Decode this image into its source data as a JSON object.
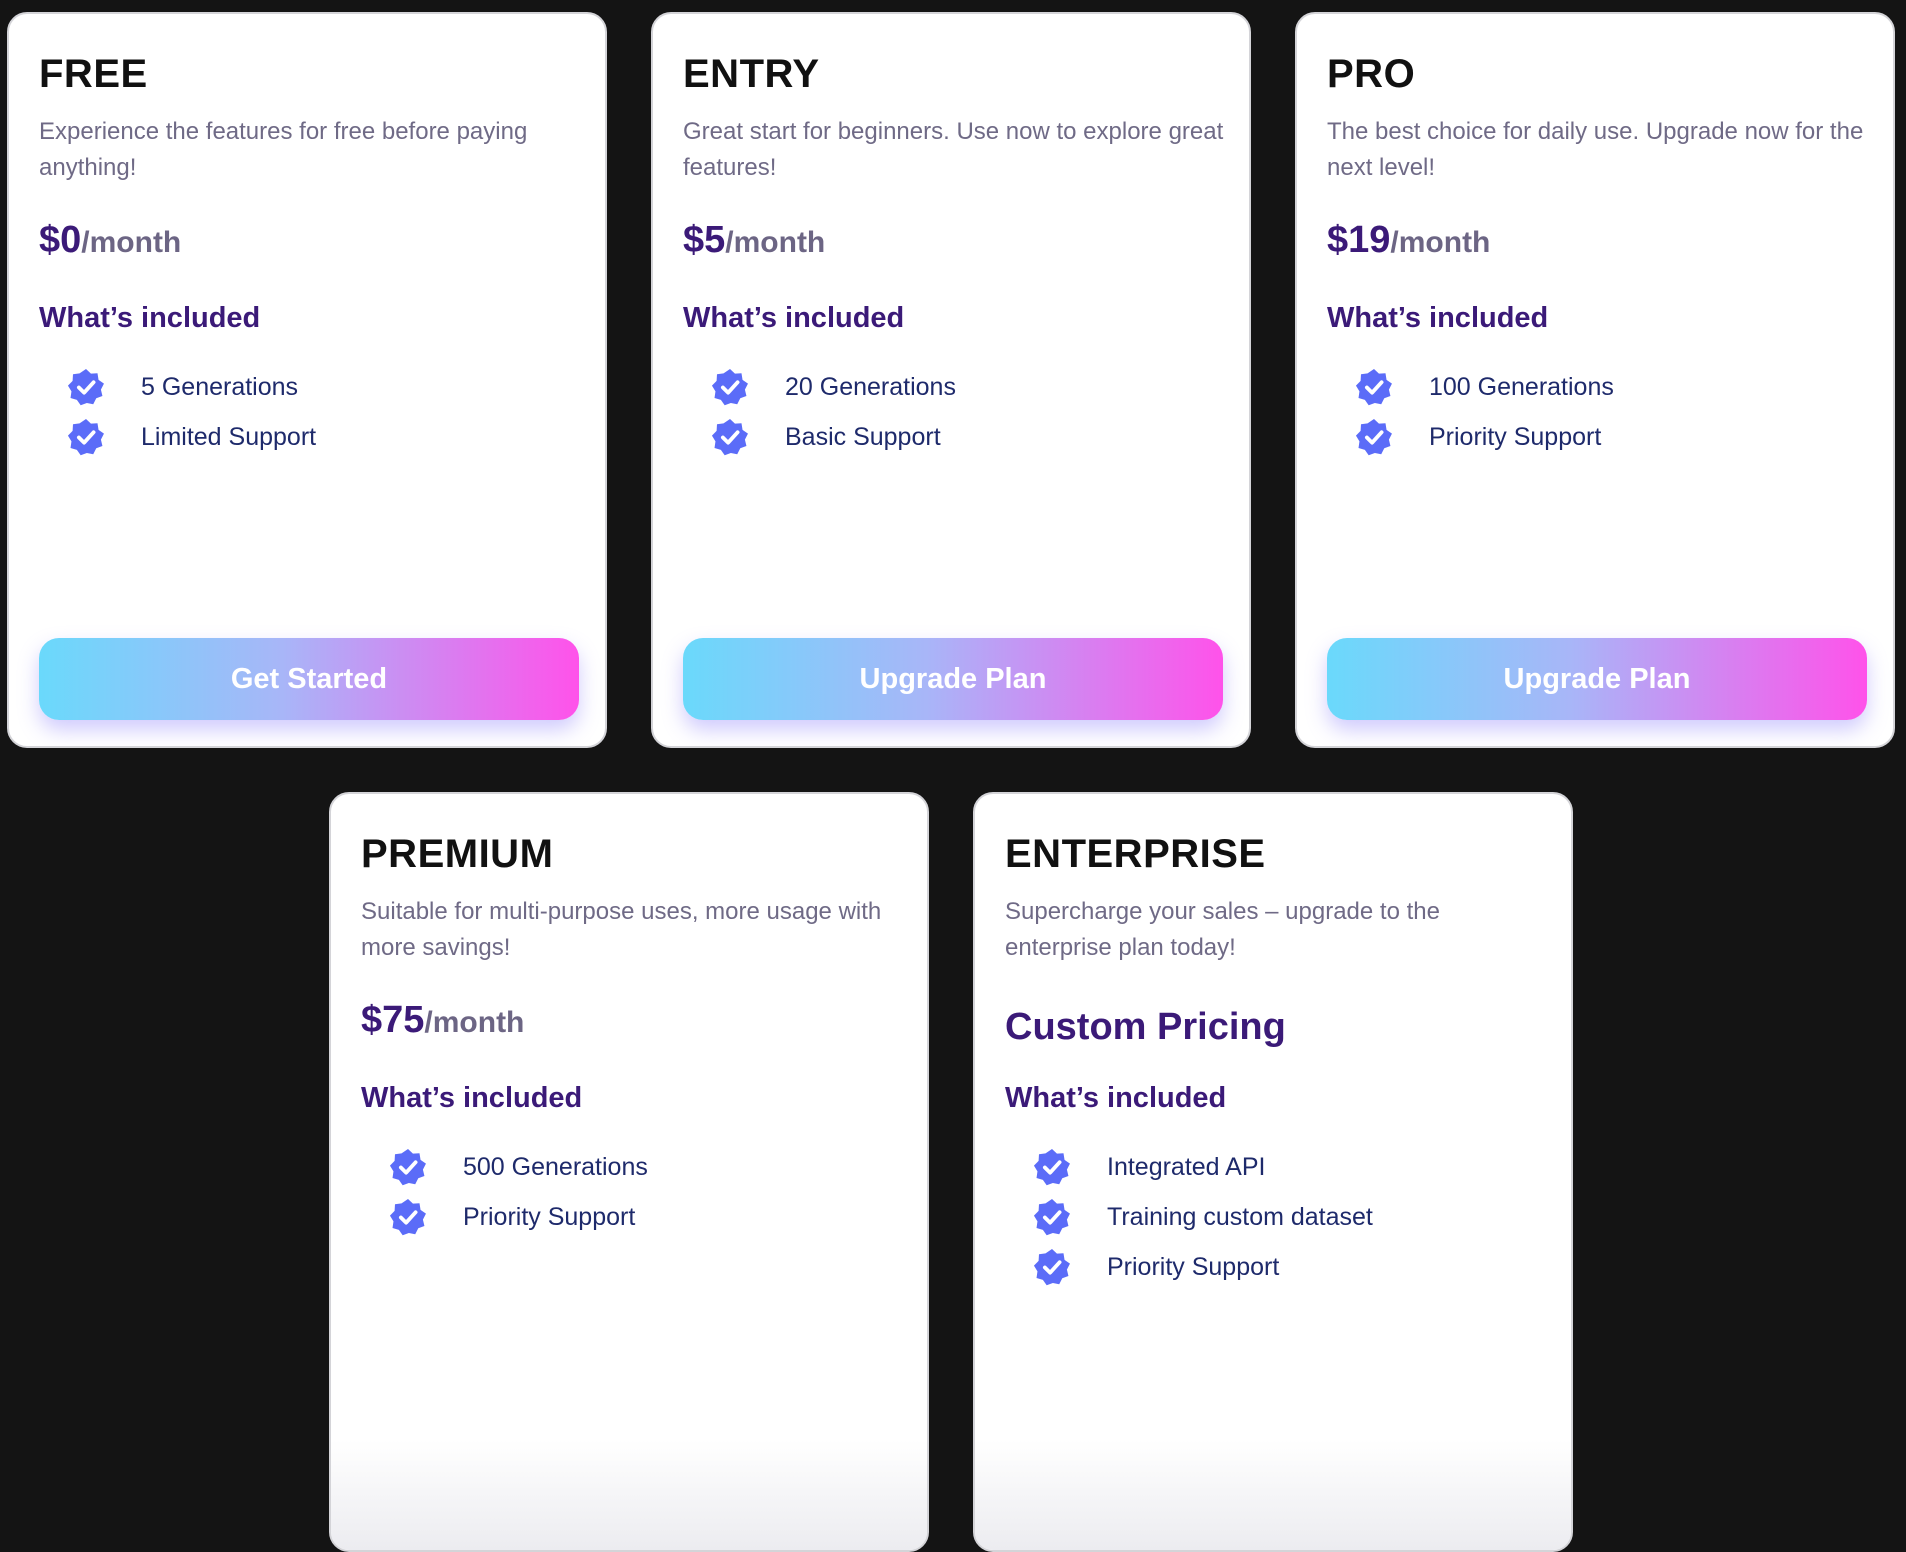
{
  "included_title": "What’s included",
  "price_period": "/month",
  "colors": {
    "background": "#141414",
    "card": "#ffffff",
    "accent_purple": "#3b1a78",
    "check_blue": "#5b6cf8",
    "button_gradient_start": "#6ad9fb",
    "button_gradient_end": "#ff52ea"
  },
  "icons": {
    "feature_check": "check-badge-icon"
  },
  "plans": [
    {
      "name": "FREE",
      "description": "Experience the features for free before paying anything!",
      "price": "$0",
      "features": [
        "5 Generations",
        "Limited Support"
      ],
      "button_label": "Get Started"
    },
    {
      "name": "ENTRY",
      "description": "Great start for beginners. Use now to explore great features!",
      "price": "$5",
      "features": [
        "20 Generations",
        "Basic Support"
      ],
      "button_label": "Upgrade Plan"
    },
    {
      "name": "PRO",
      "description": "The best choice for daily use. Upgrade now for the next level!",
      "price": "$19",
      "features": [
        "100 Generations",
        "Priority Support"
      ],
      "button_label": "Upgrade Plan"
    },
    {
      "name": "PREMIUM",
      "description": "Suitable for multi-purpose uses, more usage with more savings!",
      "price": "$75",
      "features": [
        "500 Generations",
        "Priority Support"
      ]
    },
    {
      "name": "ENTERPRISE",
      "description": "Supercharge your sales – upgrade to the enterprise plan today!",
      "price_text": "Custom Pricing",
      "features": [
        "Integrated API",
        "Training custom dataset",
        "Priority Support"
      ]
    }
  ]
}
